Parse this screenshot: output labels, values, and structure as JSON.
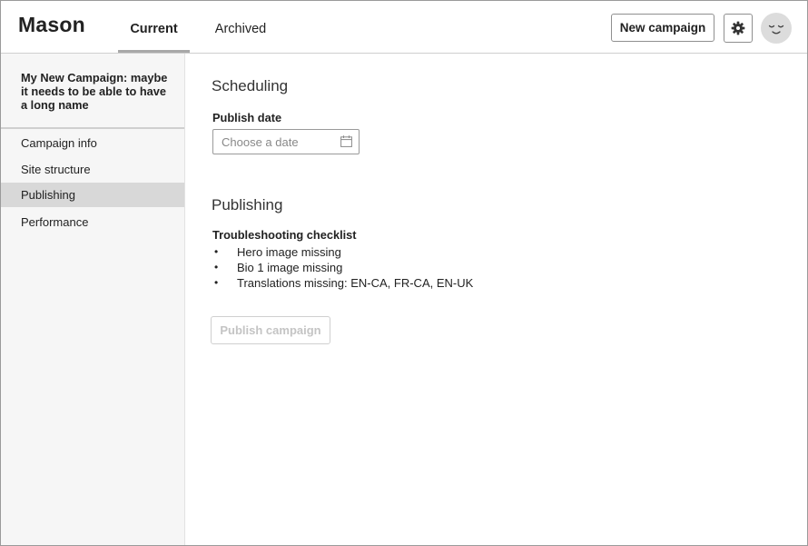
{
  "app": {
    "name": "Mason"
  },
  "header": {
    "tabs": [
      {
        "label": "Current",
        "active": true
      },
      {
        "label": "Archived",
        "active": false
      }
    ],
    "new_campaign_label": "New campaign",
    "settings_icon": "gear-icon",
    "avatar_icon": "sleepy-face-icon"
  },
  "sidebar": {
    "campaign_name": "My New Campaign: maybe it needs to be able to have a long name",
    "items": [
      {
        "label": "Campaign info",
        "active": false
      },
      {
        "label": "Site structure",
        "active": false
      },
      {
        "label": "Publishing",
        "active": true
      },
      {
        "label": "Performance",
        "active": false
      }
    ]
  },
  "scheduling": {
    "title": "Scheduling",
    "publish_date_label": "Publish date",
    "publish_date_value": "",
    "publish_date_placeholder": "Choose a date",
    "calendar_icon": "calendar-icon"
  },
  "publishing": {
    "title": "Publishing",
    "checklist_title": "Troubleshooting checklist",
    "bullet": "•",
    "checklist": [
      "Hero image missing",
      "Bio 1 image missing",
      "Translations missing: EN-CA, FR-CA, EN-UK"
    ],
    "publish_button_label": "Publish campaign",
    "publish_button_disabled": true
  },
  "colors": {
    "active_nav_bg": "#d8d8d8",
    "sidebar_bg": "#f6f6f6",
    "tab_underline": "#a8a8a8",
    "disabled_text": "#c4c4c4"
  }
}
